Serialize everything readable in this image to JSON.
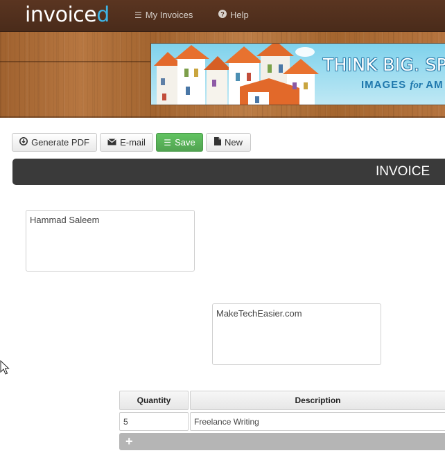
{
  "app": {
    "logo_main": "invoice",
    "logo_accent": "d"
  },
  "nav": {
    "my_invoices": "My Invoices",
    "help": "Help"
  },
  "banner": {
    "line1": "THINK BIG. SPE",
    "line2_a": "IMAGES ",
    "line2_b": "for",
    "line2_c": " AM"
  },
  "toolbar": {
    "generate_pdf": "Generate PDF",
    "email": "E-mail",
    "save": "Save",
    "new": "New"
  },
  "invoice": {
    "title": "INVOICE",
    "from_text": "Hammad Saleem",
    "to_text": "MakeTechEasier.com"
  },
  "table": {
    "headers": [
      "Quantity",
      "Description"
    ],
    "rows": [
      [
        "5",
        "Freelance Writing"
      ]
    ],
    "add_row_symbol": "+"
  },
  "colors": {
    "accent": "#3fb4e5",
    "save_green": "#5bb75b",
    "dark_bar": "#3a3a3a"
  },
  "icons": {
    "my_invoices": "list-icon",
    "help": "question-circle-icon",
    "generate_pdf": "download-circle-icon",
    "email": "envelope-icon",
    "save": "list-icon",
    "new": "file-icon"
  }
}
